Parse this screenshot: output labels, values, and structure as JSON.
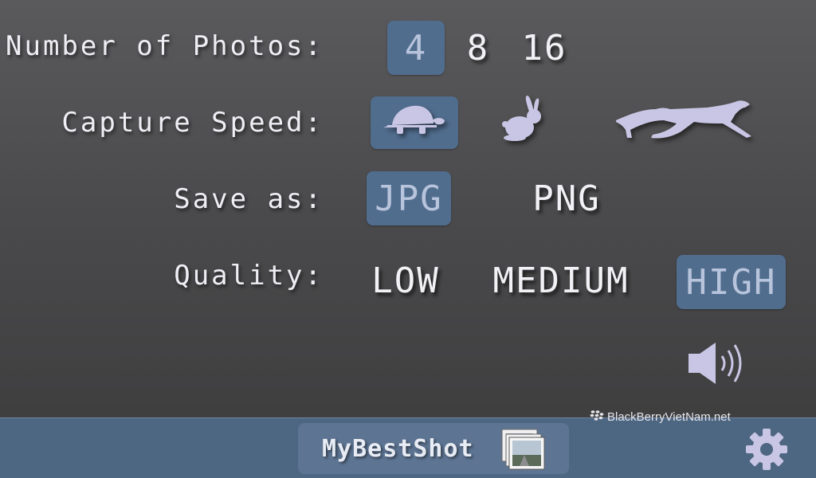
{
  "settings": {
    "photos": {
      "label": "Number of Photos:",
      "options": [
        "4",
        "8",
        "16"
      ],
      "selected": "4"
    },
    "speed": {
      "label": "Capture Speed:",
      "options": [
        "turtle-icon",
        "rabbit-icon",
        "cheetah-icon"
      ],
      "selected": "turtle-icon"
    },
    "format": {
      "label": "Save as:",
      "options": [
        "JPG",
        "PNG"
      ],
      "selected": "JPG"
    },
    "quality": {
      "label": "Quality:",
      "options": [
        "LOW",
        "MEDIUM",
        "HIGH"
      ],
      "selected": "HIGH"
    }
  },
  "sound": {
    "icon": "speaker-icon"
  },
  "watermark": {
    "text": "BlackBerryVietNam.net"
  },
  "bottom_bar": {
    "app_name": "MyBestShot",
    "photos_icon": "photo-stack-icon",
    "settings_icon": "gear-icon"
  },
  "colors": {
    "selected_bg": "#516d8e",
    "selected_text": "#b8c4dc",
    "bar_bg": "#4d6682",
    "icon_fill": "#c8c6e4"
  }
}
